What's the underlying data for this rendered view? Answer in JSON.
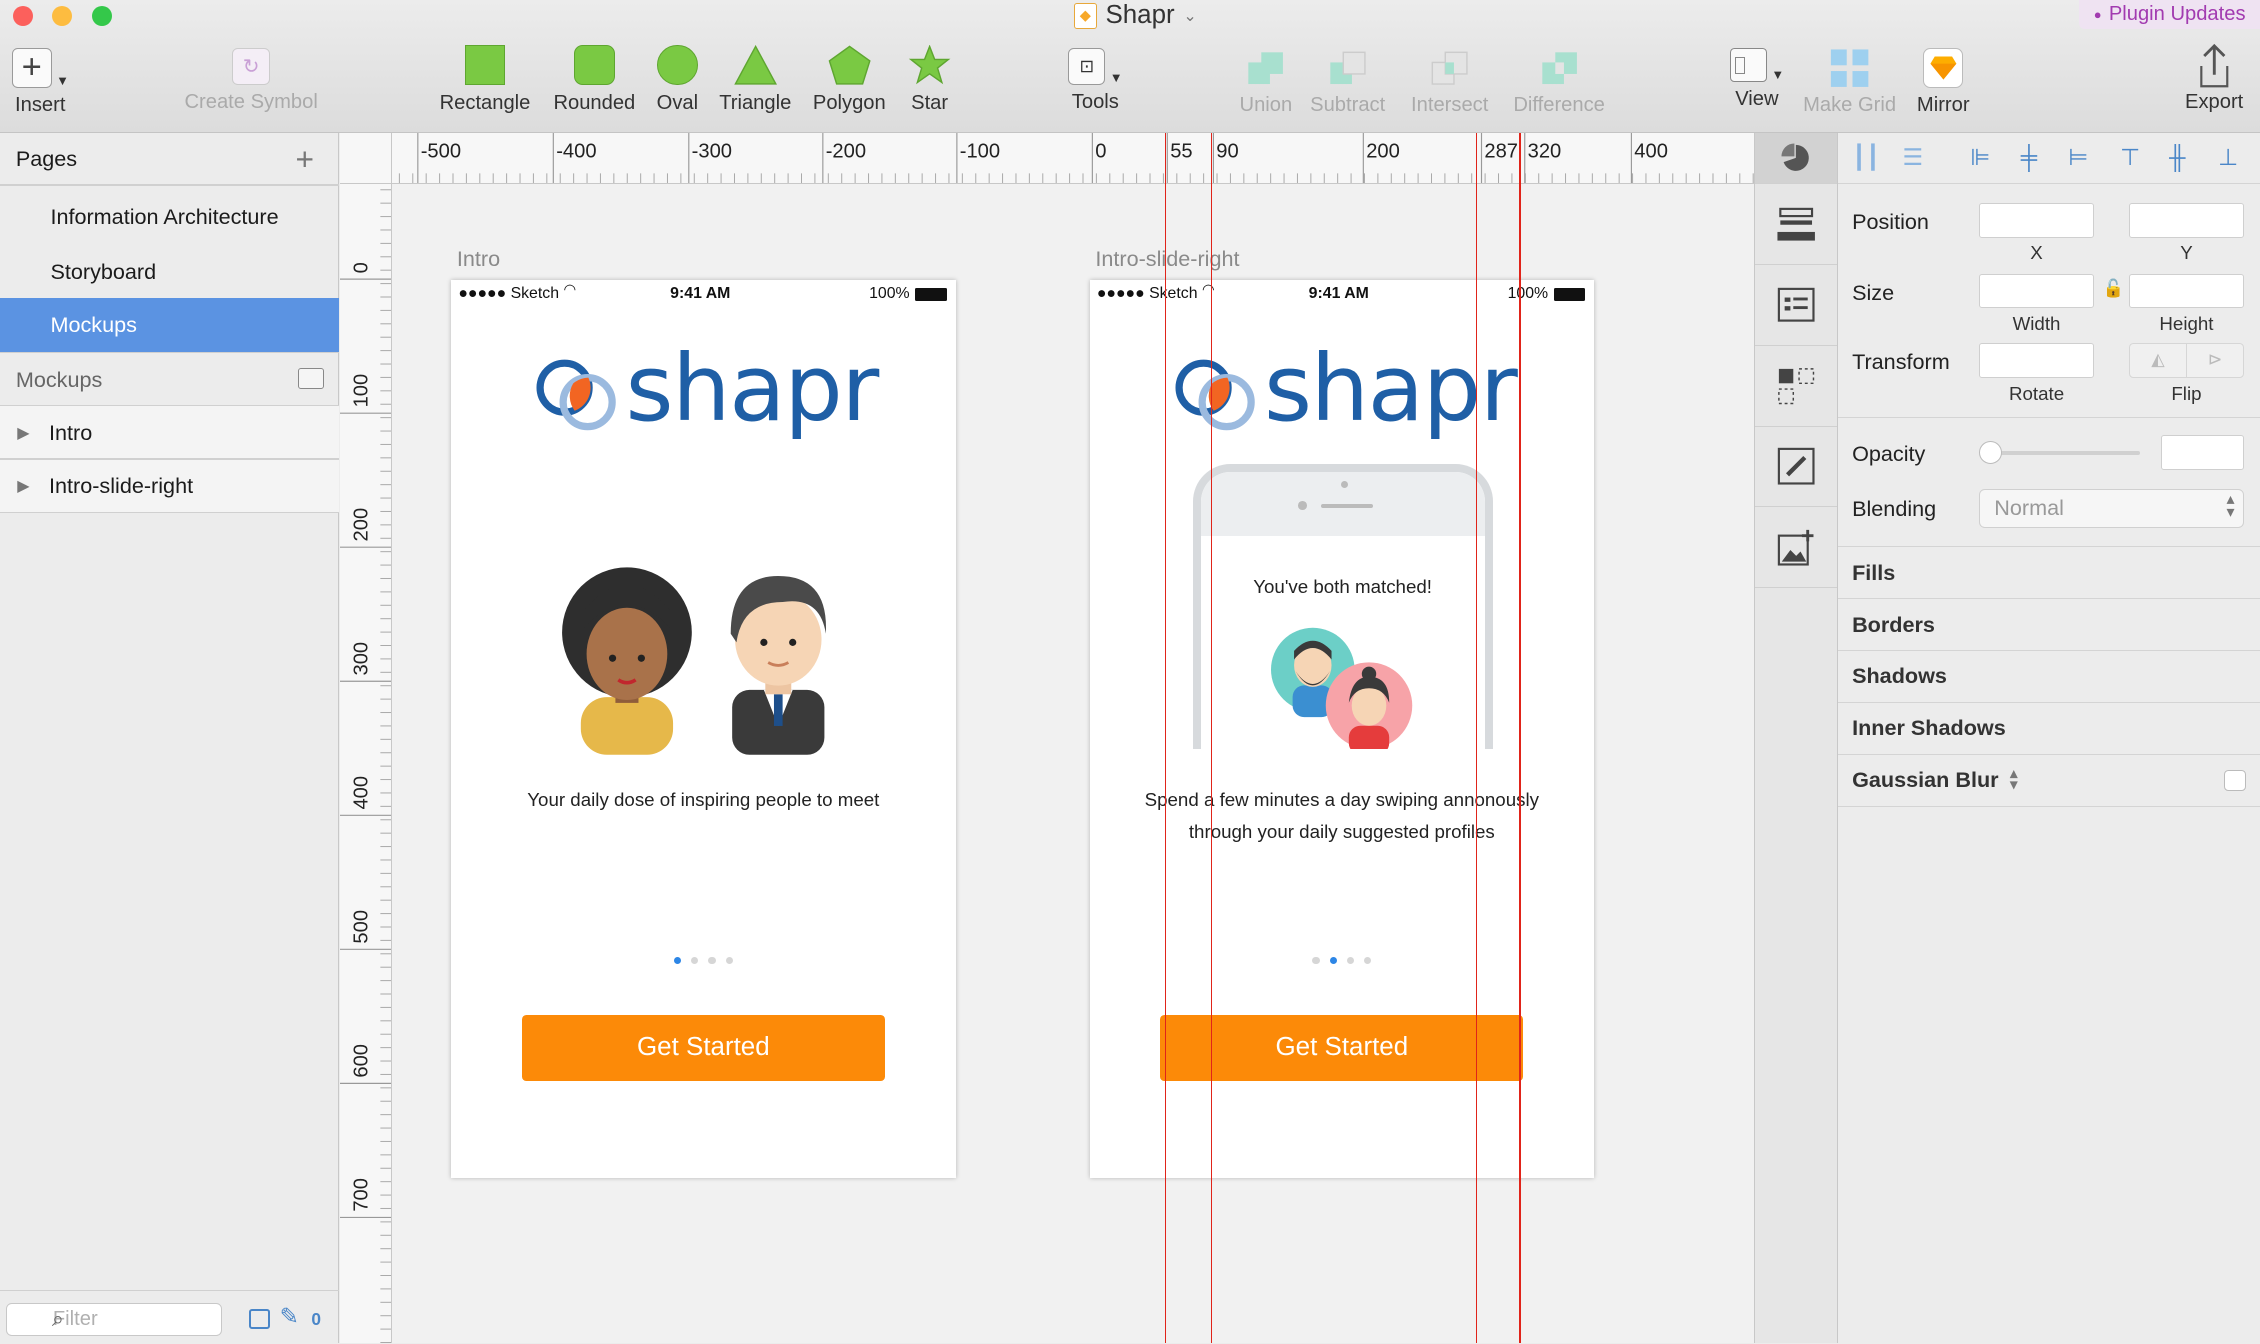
{
  "window": {
    "title": "Shapr",
    "plugin_updates": "Plugin Updates"
  },
  "toolbar": {
    "insert": "Insert",
    "create_symbol": "Create Symbol",
    "shapes": [
      "Rectangle",
      "Rounded",
      "Oval",
      "Triangle",
      "Polygon",
      "Star"
    ],
    "tools": "Tools",
    "boolean": [
      "Union",
      "Subtract",
      "Intersect",
      "Difference"
    ],
    "view": "View",
    "make_grid": "Make Grid",
    "mirror": "Mirror",
    "export": "Export"
  },
  "pages_panel": {
    "title": "Pages",
    "pages": [
      "Information Architecture",
      "Storyboard",
      "Mockups"
    ],
    "selected_page": "Mockups",
    "layers_title": "Mockups",
    "layers": [
      "Intro",
      "Intro-slide-right"
    ],
    "filter_placeholder": "Filter",
    "edit_count": "0"
  },
  "rulers": {
    "horizontal": [
      "-500",
      "-400",
      "-300",
      "-200",
      "-100",
      "0",
      "55",
      "90",
      "200",
      "287",
      "320",
      "400"
    ],
    "vertical": [
      "0",
      "100",
      "200",
      "300",
      "400",
      "500",
      "600",
      "700"
    ]
  },
  "artboards": [
    {
      "label": "Intro",
      "status_carrier": "●●●●● Sketch",
      "status_time": "9:41 AM",
      "status_battery": "100%",
      "logo_text": "shapr",
      "description": "Your daily dose of inspiring people to meet",
      "button": "Get Started",
      "active_dot": 0
    },
    {
      "label": "Intro-slide-right",
      "status_carrier": "●●●●● Sketch",
      "status_time": "9:41 AM",
      "status_battery": "100%",
      "logo_text": "shapr",
      "matched_text": "You've both matched!",
      "description": "Spend a few minutes a day swiping annonously through your daily suggested profiles",
      "button": "Get Started",
      "active_dot": 1
    }
  ],
  "inspector": {
    "position": "Position",
    "x": "X",
    "y": "Y",
    "size": "Size",
    "width": "Width",
    "height": "Height",
    "transform": "Transform",
    "rotate": "Rotate",
    "flip": "Flip",
    "opacity": "Opacity",
    "blending": "Blending",
    "blending_value": "Normal",
    "sections": [
      "Fills",
      "Borders",
      "Shadows",
      "Inner Shadows",
      "Gaussian Blur"
    ]
  },
  "colors": {
    "accent": "#fc8a08",
    "selection": "#5b93e2",
    "guide": "#e0241a",
    "logo_blue": "#1f5fa6",
    "logo_orange": "#f26522"
  }
}
